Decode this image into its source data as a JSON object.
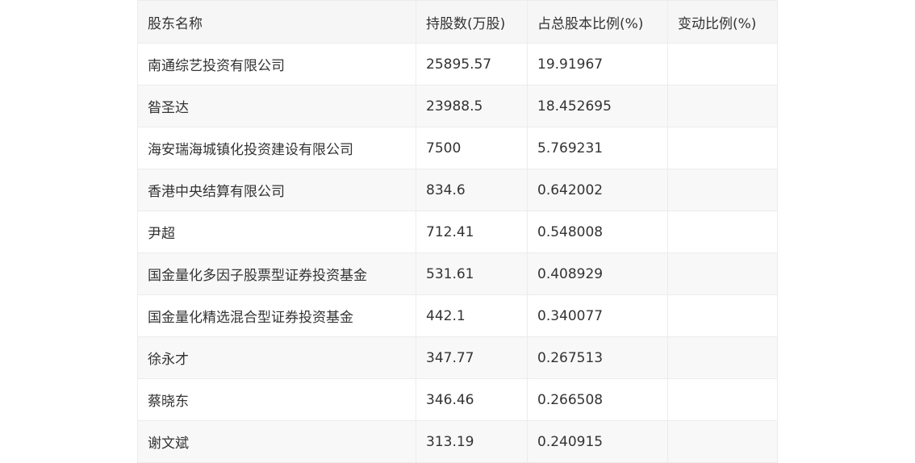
{
  "table": {
    "headers": [
      "股东名称",
      "持股数(万股)",
      "占总股本比例(%)",
      "变动比例(%)"
    ],
    "rows": [
      [
        "南通综艺投资有限公司",
        "25895.57",
        "19.91967",
        ""
      ],
      [
        "昝圣达",
        "23988.5",
        "18.452695",
        ""
      ],
      [
        "海安瑞海城镇化投资建设有限公司",
        "7500",
        "5.769231",
        ""
      ],
      [
        "香港中央结算有限公司",
        "834.6",
        "0.642002",
        ""
      ],
      [
        "尹超",
        "712.41",
        "0.548008",
        ""
      ],
      [
        "国金量化多因子股票型证券投资基金",
        "531.61",
        "0.408929",
        ""
      ],
      [
        "国金量化精选混合型证券投资基金",
        "442.1",
        "0.340077",
        ""
      ],
      [
        "徐永才",
        "347.77",
        "0.267513",
        ""
      ],
      [
        "蔡晓东",
        "346.46",
        "0.266508",
        ""
      ],
      [
        "谢文斌",
        "313.19",
        "0.240915",
        ""
      ]
    ]
  }
}
